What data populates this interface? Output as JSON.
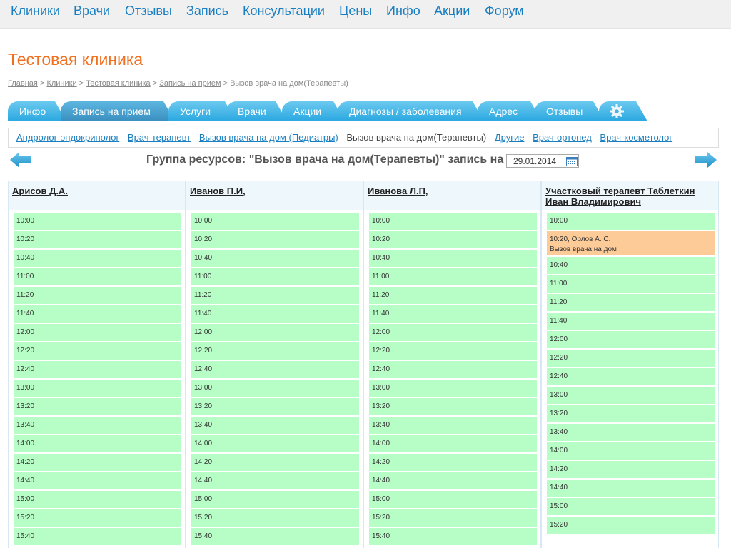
{
  "topnav": [
    "Клиники",
    "Врачи",
    "Отзывы",
    "Запись",
    "Консультации",
    "Цены",
    "Инфо",
    "Акции",
    "Форум"
  ],
  "page_title": "Тестовая клиника",
  "breadcrumb": {
    "links": [
      "Главная",
      "Клиники",
      "Тестовая клиника",
      "Запись на прием"
    ],
    "current": "Вызов врача на дом(Терапевты)",
    "separator": ">"
  },
  "tabs": [
    "Инфо",
    "Запись на прием",
    "Услуги",
    "Врачи",
    "Акции",
    "Диагнозы / заболевания",
    "Адрес",
    "Отзывы"
  ],
  "active_tab": "Запись на прием",
  "settings_icon": "gear-icon",
  "subnav": {
    "links_before": [
      "Андролог-эндокринолог",
      "Врач-терапевт",
      "Вызов врача на дом (Педиатры)"
    ],
    "current": "Вызов врача на дом(Терапевты)",
    "links_after": [
      "Другие",
      "Врач-ортопед",
      "Врач-косметолог"
    ]
  },
  "group_title": "Группа ресурсов: \"Вызов врача на дом(Терапевты)\" запись на",
  "date": "29.01.2014",
  "colors": {
    "accent": "#1a7fc1",
    "title": "#f07020",
    "tab": "#2aa8e0",
    "free_slot": "#b6fec6",
    "booked_slot": "#fccb98"
  },
  "doctors": [
    {
      "name": "Арисов Д.А.",
      "slots": [
        {
          "time": "10:00"
        },
        {
          "time": "10:20"
        },
        {
          "time": "10:40"
        },
        {
          "time": "11:00"
        },
        {
          "time": "11:20"
        },
        {
          "time": "11:40"
        },
        {
          "time": "12:00"
        },
        {
          "time": "12:20"
        },
        {
          "time": "12:40"
        },
        {
          "time": "13:00"
        },
        {
          "time": "13:20"
        },
        {
          "time": "13:40"
        },
        {
          "time": "14:00"
        },
        {
          "time": "14:20"
        },
        {
          "time": "14:40"
        },
        {
          "time": "15:00"
        },
        {
          "time": "15:20"
        },
        {
          "time": "15:40"
        }
      ]
    },
    {
      "name": "Иванов П.И,",
      "slots": [
        {
          "time": "10:00"
        },
        {
          "time": "10:20"
        },
        {
          "time": "10:40"
        },
        {
          "time": "11:00"
        },
        {
          "time": "11:20"
        },
        {
          "time": "11:40"
        },
        {
          "time": "12:00"
        },
        {
          "time": "12:20"
        },
        {
          "time": "12:40"
        },
        {
          "time": "13:00"
        },
        {
          "time": "13:20"
        },
        {
          "time": "13:40"
        },
        {
          "time": "14:00"
        },
        {
          "time": "14:20"
        },
        {
          "time": "14:40"
        },
        {
          "time": "15:00"
        },
        {
          "time": "15:20"
        },
        {
          "time": "15:40"
        }
      ]
    },
    {
      "name": "Иванова Л.П,",
      "slots": [
        {
          "time": "10:00"
        },
        {
          "time": "10:20"
        },
        {
          "time": "10:40"
        },
        {
          "time": "11:00"
        },
        {
          "time": "11:20"
        },
        {
          "time": "11:40"
        },
        {
          "time": "12:00"
        },
        {
          "time": "12:20"
        },
        {
          "time": "12:40"
        },
        {
          "time": "13:00"
        },
        {
          "time": "13:20"
        },
        {
          "time": "13:40"
        },
        {
          "time": "14:00"
        },
        {
          "time": "14:20"
        },
        {
          "time": "14:40"
        },
        {
          "time": "15:00"
        },
        {
          "time": "15:20"
        },
        {
          "time": "15:40"
        }
      ]
    },
    {
      "name": "Участковый терапевт Таблеткин Иван Владимирович",
      "slots": [
        {
          "time": "10:00"
        },
        {
          "time": "10:20",
          "booked": true,
          "patient": "Орлов А. С.",
          "note": "Вызов врача на дом"
        },
        {
          "time": "10:40"
        },
        {
          "time": "11:00"
        },
        {
          "time": "11:20"
        },
        {
          "time": "11:40"
        },
        {
          "time": "12:00"
        },
        {
          "time": "12:20"
        },
        {
          "time": "12:40"
        },
        {
          "time": "13:00"
        },
        {
          "time": "13:20"
        },
        {
          "time": "13:40"
        },
        {
          "time": "14:00"
        },
        {
          "time": "14:20"
        },
        {
          "time": "14:40"
        },
        {
          "time": "15:00"
        },
        {
          "time": "15:20"
        }
      ]
    }
  ]
}
